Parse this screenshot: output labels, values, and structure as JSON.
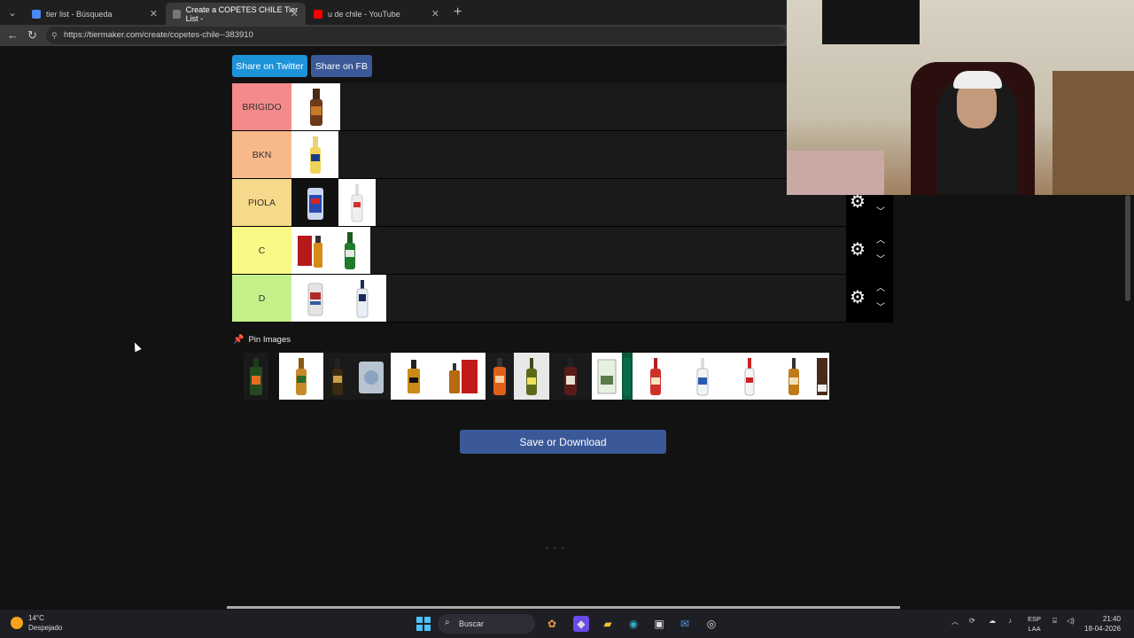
{
  "browser": {
    "tabs": [
      {
        "title": "tier list - Búsqueda",
        "favicon_color": "#4a8af4"
      },
      {
        "title": "Create a COPETES CHILE Tier List -",
        "favicon_color": "#777777"
      },
      {
        "title": "u de chile - YouTube",
        "favicon_color": "#ff0000"
      }
    ],
    "url": "https://tiermaker.com/create/copetes-chile--383910",
    "close_glyph": "✕",
    "new_tab_glyph": "+"
  },
  "share": {
    "twitter": "Share on Twitter",
    "facebook": "Share on FB"
  },
  "tiers": [
    {
      "label": "BRIGIDO",
      "color": "#f58a8a",
      "items": [
        "beer-bottle-brown"
      ]
    },
    {
      "label": "BKN",
      "color": "#f8b98a",
      "items": [
        "beer-bottle-corona"
      ]
    },
    {
      "label": "PIOLA",
      "color": "#f6d98a",
      "items": [
        "beer-can-blue",
        "pisco-bottle-white"
      ]
    },
    {
      "label": "C",
      "color": "#f9f986",
      "items": [
        "whisky-red-box",
        "beer-bottle-green"
      ]
    },
    {
      "label": "D",
      "color": "#c6f18a",
      "items": [
        "beer-can-white",
        "vodka-bottle-clear"
      ]
    }
  ],
  "pin_images": {
    "label": "Pin Images"
  },
  "pool_items": [
    "jagermeister-bottle",
    "beer-bottle-amber",
    "beer-bottle-dark",
    "mistral-ice-pack",
    "whisky-bottle",
    "whisky-gift-box",
    "whisky-orange",
    "wine-bottle-green",
    "rum-bottle-dark",
    "wine-box-white",
    "wine-tall-box",
    "aperitif-red-bottle",
    "pisco-blue-bottle",
    "vodka-clear-bottle",
    "rum-amber-bottle",
    "rum-750-box"
  ],
  "save_button": "Save or Download",
  "taskbar": {
    "temperature": "14°C",
    "weather": "Despejado",
    "search_label": "Buscar",
    "lang_line1": "ESP",
    "lang_line2": "LAA",
    "time": "21:40",
    "date": "18-04-2026"
  }
}
